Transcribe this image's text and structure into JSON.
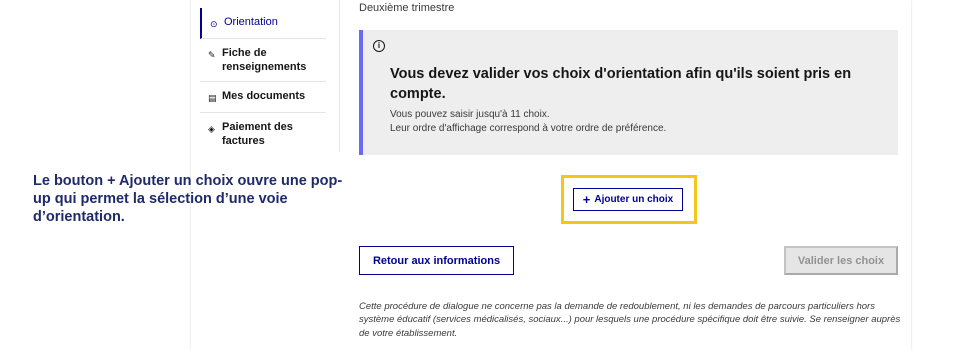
{
  "sidebar": {
    "items": [
      {
        "icon": "compass-icon",
        "glyph": "⊙",
        "label": "Orientation",
        "active": true
      },
      {
        "icon": "edit-icon",
        "glyph": "✎",
        "label": "Fiche de renseignements",
        "active": false
      },
      {
        "icon": "documents-icon",
        "glyph": "▤",
        "label": "Mes documents",
        "active": false
      },
      {
        "icon": "payment-icon",
        "glyph": "◈",
        "label": "Paiement des factures",
        "active": false
      }
    ]
  },
  "main": {
    "trimestre": "Deuxième trimestre",
    "notice": {
      "icon": "info-icon",
      "icon_glyph": "i",
      "title": "Vous devez valider vos choix d'orientation afin qu'ils soient pris en compte.",
      "line1": "Vous pouvez saisir jusqu'à 11 choix.",
      "line2": "Leur ordre d'affichage correspond à votre ordre de préférence."
    },
    "add_button": {
      "plus": "+",
      "label": "Ajouter un choix"
    },
    "back_button": "Retour aux informations",
    "validate_button": "Valider les choix",
    "footnote": "Cette procédure de dialogue ne concerne pas la demande de redoublement, ni les demandes de parcours particuliers hors système éducatif (services médicalisés, sociaux...) pour lesquels une procédure spécifique doit être suivie. Se renseigner auprès de votre établissement."
  },
  "annotation": {
    "text": "Le bouton + Ajouter un choix ouvre une pop-up qui permet la sélection d’une voie d’orientation."
  },
  "colors": {
    "primary_blue": "#000091",
    "notice_accent": "#6a6af4",
    "highlight": "#f5c518",
    "annotation_text": "#1f2a6b"
  }
}
